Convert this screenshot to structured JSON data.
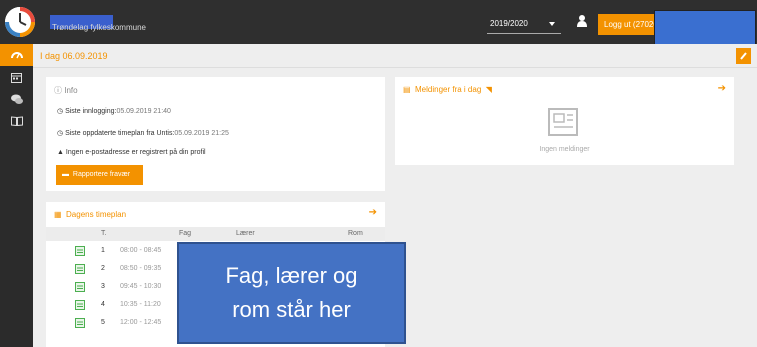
{
  "header": {
    "org_name": "Trøndelag fylkeskommune",
    "year": "2019/2020",
    "logout_label": "Logg ut (27020"
  },
  "date_bar": {
    "label": "I dag 06.09.2019"
  },
  "info": {
    "title": "Info",
    "last_login_label": "Siste innlogging:",
    "last_login_value": "05.09.2019 21:40",
    "last_timetable_label": "Siste oppdaterte timeplan fra Untis:",
    "last_timetable_value": "05.09.2019 21:25",
    "no_email": "Ingen e-postadresse er registrert på din profil",
    "report_button": "Rapportere fravær"
  },
  "messages": {
    "title": "Meldinger fra i dag",
    "empty": "Ingen meldinger"
  },
  "timetable": {
    "title": "Dagens timeplan",
    "columns": [
      "T.",
      "Fag",
      "Lærer",
      "Rom"
    ],
    "rows": [
      {
        "idx": "1",
        "time": "08:00 - 08:45"
      },
      {
        "idx": "2",
        "time": "08:50 - 09:35"
      },
      {
        "idx": "3",
        "time": "09:45 - 10:30"
      },
      {
        "idx": "4",
        "time": "10:35 - 11:20"
      },
      {
        "idx": "5",
        "time": "12:00 - 12:45"
      }
    ]
  },
  "overlay": {
    "line1": "Fag, lærer og",
    "line2": "rom står her"
  },
  "colors": {
    "accent": "#f39200",
    "topbar": "#2f2f2f",
    "sidebar": "#2b2b2b",
    "overlay": "#4472c4"
  }
}
